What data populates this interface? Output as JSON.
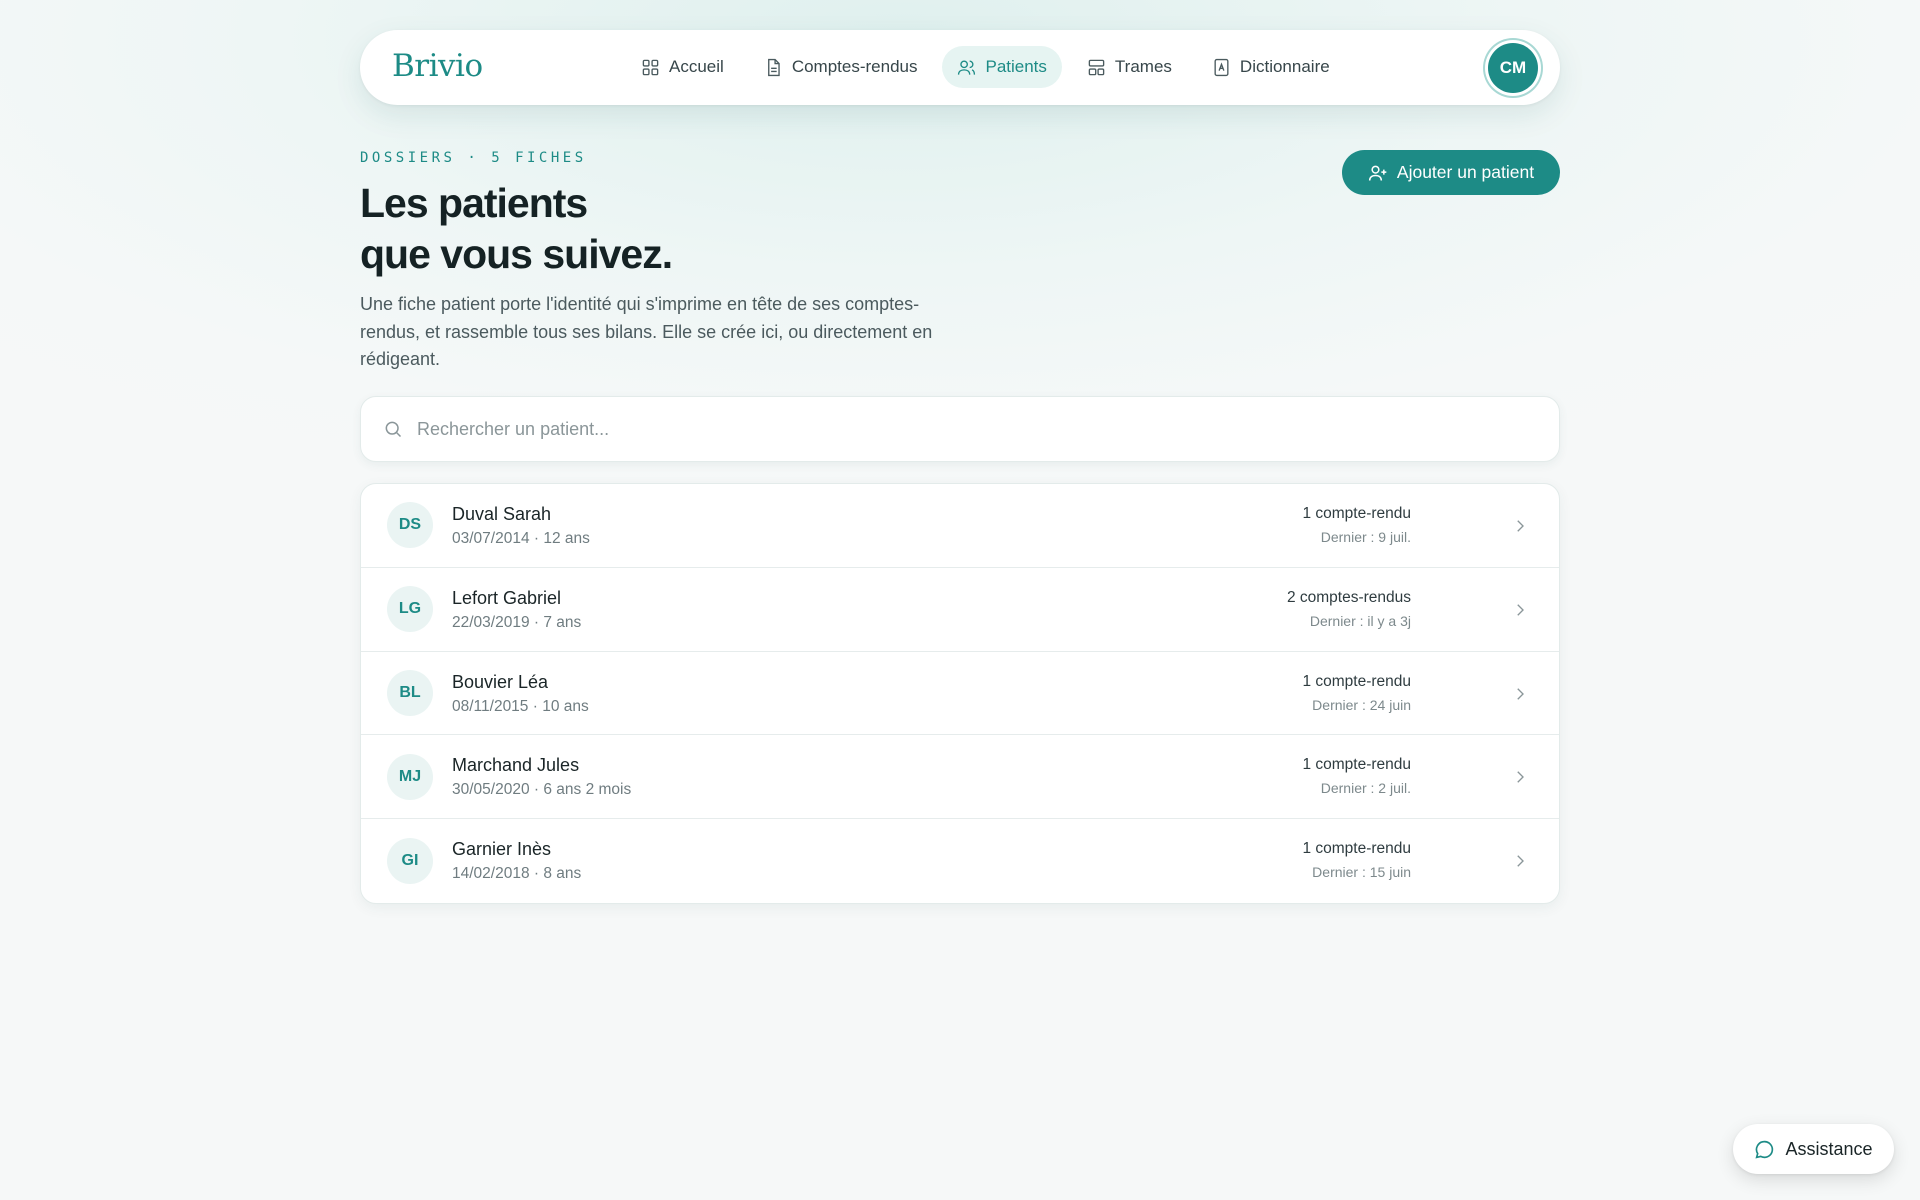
{
  "brand": {
    "logo": "Brivio",
    "accent": "#1d8b86"
  },
  "nav": {
    "items": [
      {
        "label": "Accueil",
        "icon": "grid-icon",
        "active": false
      },
      {
        "label": "Comptes-rendus",
        "icon": "document-icon",
        "active": false
      },
      {
        "label": "Patients",
        "icon": "users-icon",
        "active": true
      },
      {
        "label": "Trames",
        "icon": "layout-icon",
        "active": false
      },
      {
        "label": "Dictionnaire",
        "icon": "book-icon",
        "active": false
      }
    ],
    "user_initials": "CM"
  },
  "header": {
    "eyebrow": "DOSSIERS · 5 FICHES",
    "title_line1": "Les patients",
    "title_line2": "que vous suivez.",
    "description": "Une fiche patient porte l'identité qui s'imprime en tête de ses comptes-rendus, et rassemble tous ses bilans. Elle se crée ici, ou directement en rédigeant.",
    "add_button": "Ajouter un patient"
  },
  "search": {
    "placeholder": "Rechercher un patient..."
  },
  "patients": [
    {
      "initials": "DS",
      "name": "Duval Sarah",
      "meta": "03/07/2014 · 12 ans",
      "count": "1 compte-rendu",
      "last": "Dernier : 9 juil."
    },
    {
      "initials": "LG",
      "name": "Lefort Gabriel",
      "meta": "22/03/2019 · 7 ans",
      "count": "2 comptes-rendus",
      "last": "Dernier : il y a 3j"
    },
    {
      "initials": "BL",
      "name": "Bouvier Léa",
      "meta": "08/11/2015 · 10 ans",
      "count": "1 compte-rendu",
      "last": "Dernier : 24 juin"
    },
    {
      "initials": "MJ",
      "name": "Marchand Jules",
      "meta": "30/05/2020 · 6 ans 2 mois",
      "count": "1 compte-rendu",
      "last": "Dernier : 2 juil."
    },
    {
      "initials": "GI",
      "name": "Garnier Inès",
      "meta": "14/02/2018 · 8 ans",
      "count": "1 compte-rendu",
      "last": "Dernier : 15 juin"
    }
  ],
  "assistance": {
    "label": "Assistance",
    "icon": "chat-icon"
  }
}
